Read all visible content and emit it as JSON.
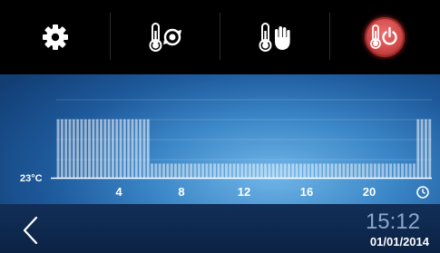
{
  "toolbar": {
    "buttons": [
      {
        "icon": "gear-icon"
      },
      {
        "icon": "thermometer-auto-icon"
      },
      {
        "icon": "thermometer-manual-icon"
      },
      {
        "icon": "thermometer-power-icon",
        "active": true
      }
    ]
  },
  "schedule": {
    "base_temp_label": "23°C",
    "hour_labels": [
      "4",
      "8",
      "12",
      "16",
      "20"
    ],
    "clock_icon": "clock-icon",
    "high_level": 0.62,
    "low_level": 0.15,
    "high_hours_start": [
      0,
      6
    ],
    "high_hours_end": [
      23,
      24
    ],
    "bar_color": "#ffffff"
  },
  "footer": {
    "back_icon": "chevron-left-icon",
    "time": "15:12",
    "date": "01/01/2014"
  }
}
